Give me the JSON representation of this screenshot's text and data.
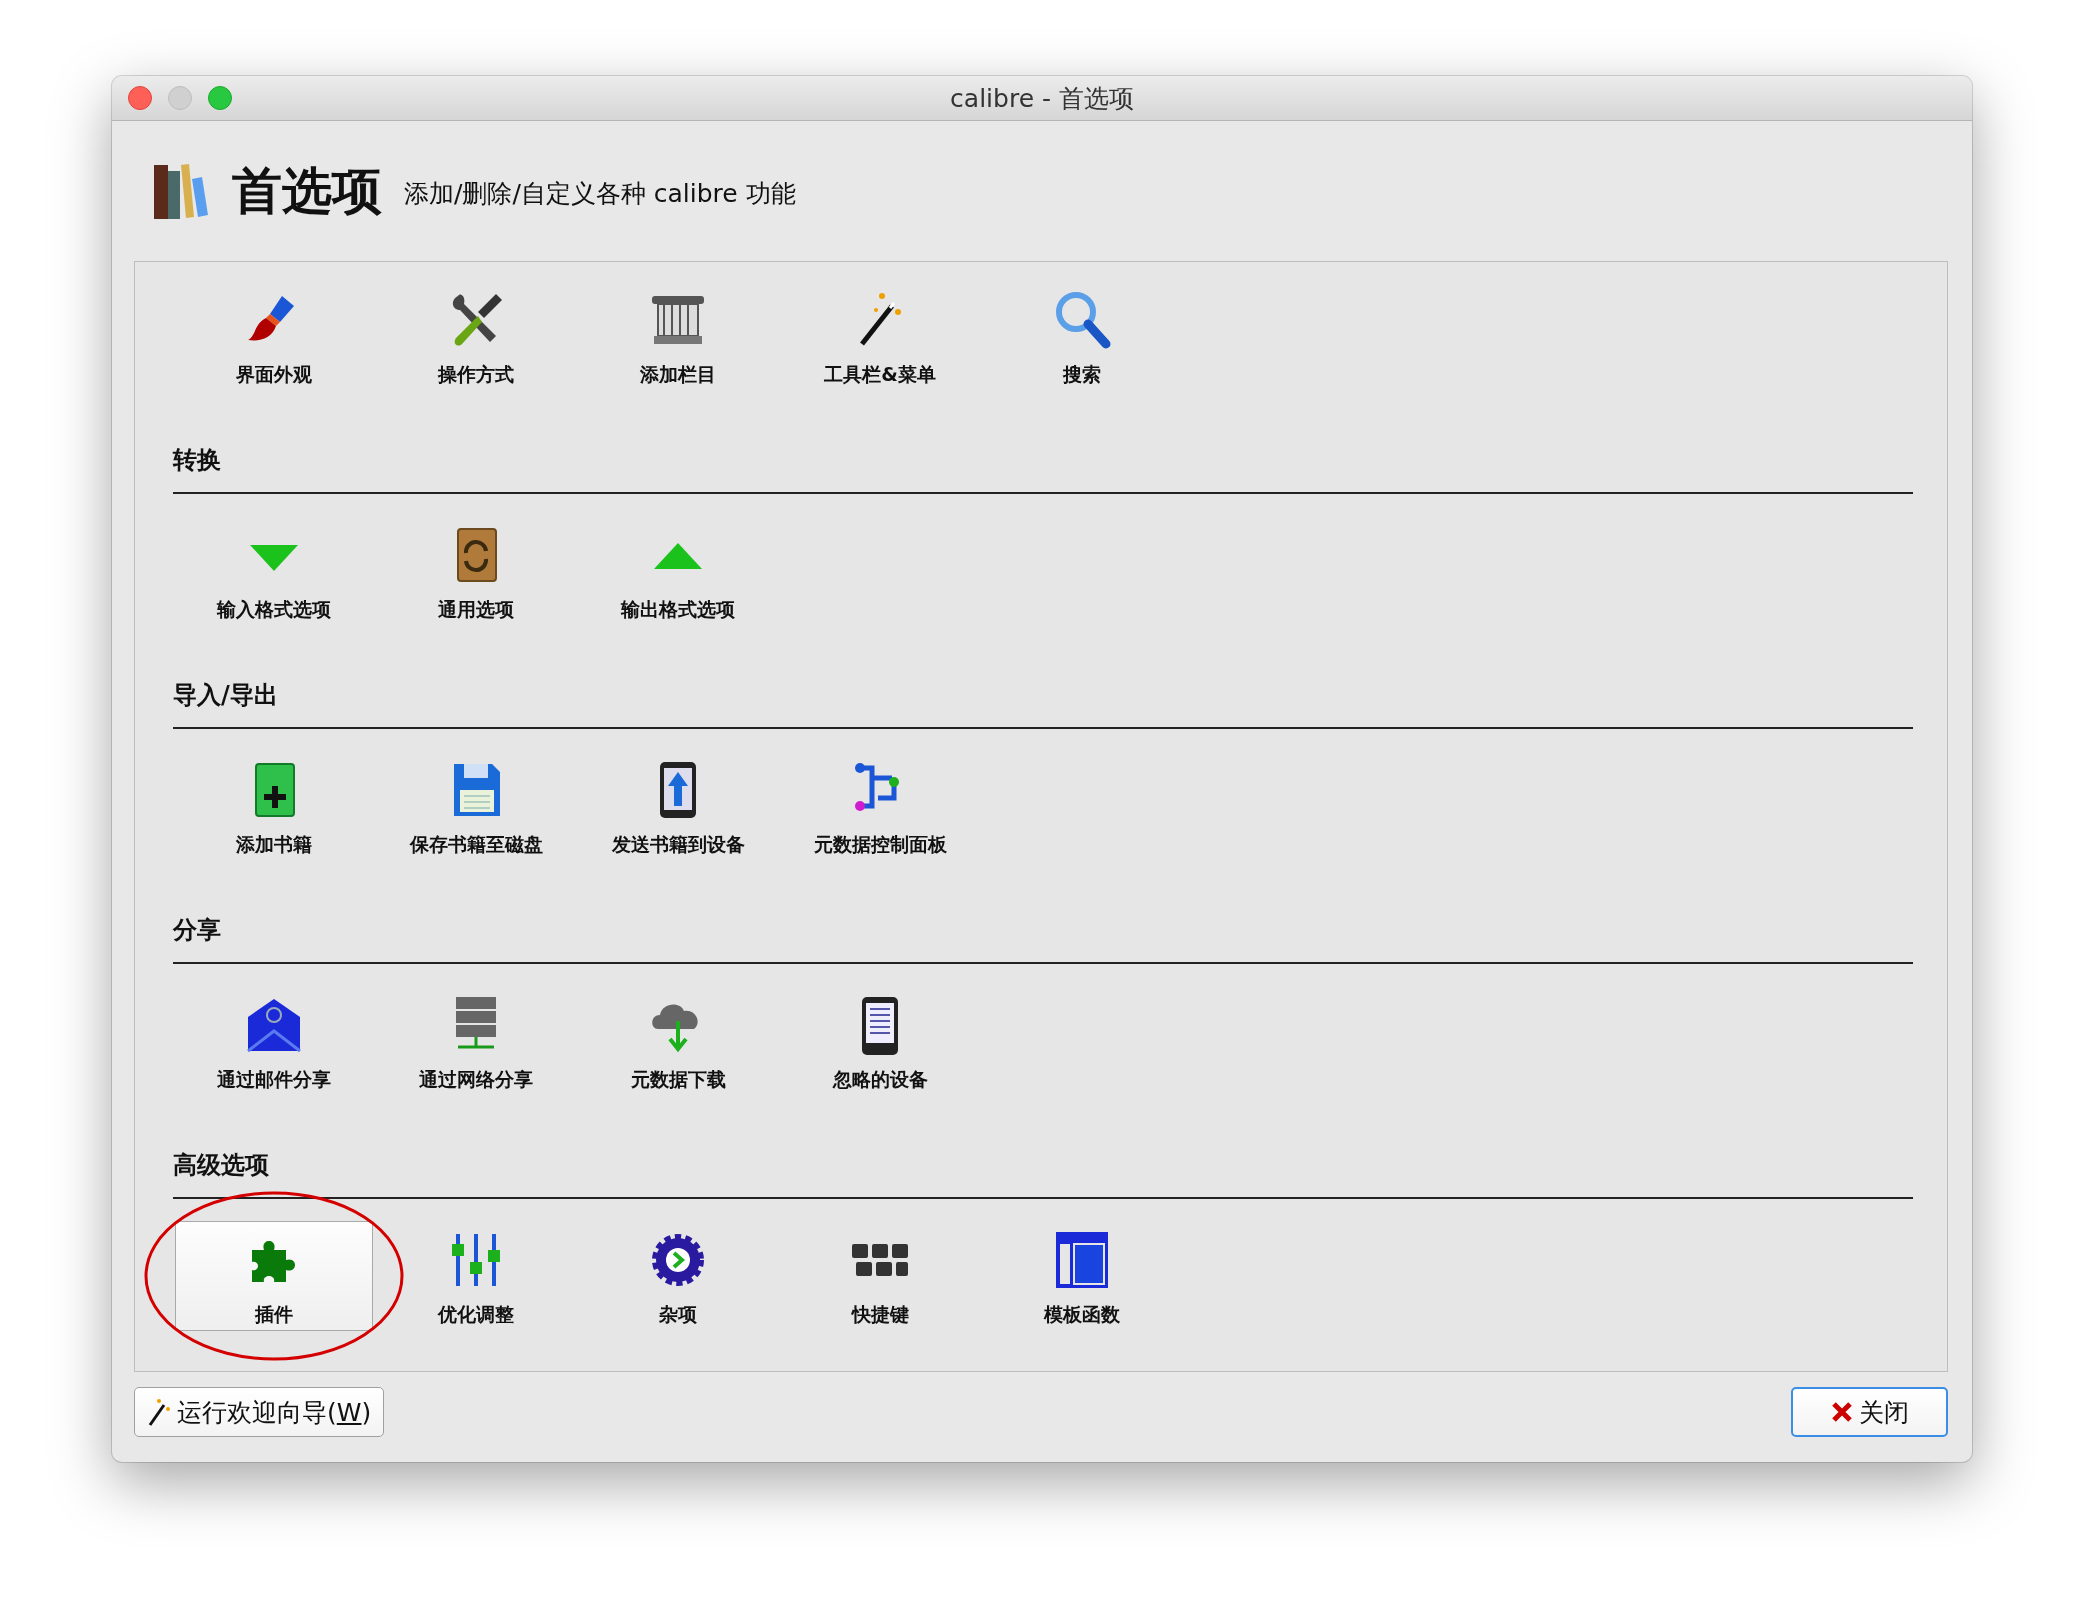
{
  "window": {
    "title": "calibre - 首选项"
  },
  "header": {
    "title": "首选项",
    "subtitle": "添加/删除/自定义各种 calibre 功能"
  },
  "sections": [
    {
      "items": [
        {
          "label": "界面外观",
          "selected": false
        },
        {
          "label": "操作方式",
          "selected": false
        },
        {
          "label": "添加栏目",
          "selected": false
        },
        {
          "label": "工具栏&菜单",
          "selected": false
        },
        {
          "label": "搜索",
          "selected": false
        }
      ]
    },
    {
      "heading": "转换",
      "items": [
        {
          "label": "输入格式选项",
          "selected": false
        },
        {
          "label": "通用选项",
          "selected": false
        },
        {
          "label": "输出格式选项",
          "selected": false
        }
      ]
    },
    {
      "heading": "导入/导出",
      "items": [
        {
          "label": "添加书籍",
          "selected": false
        },
        {
          "label": "保存书籍至磁盘",
          "selected": false
        },
        {
          "label": "发送书籍到设备",
          "selected": false
        },
        {
          "label": "元数据控制面板",
          "selected": false
        }
      ]
    },
    {
      "heading": "分享",
      "items": [
        {
          "label": "通过邮件分享",
          "selected": false
        },
        {
          "label": "通过网络分享",
          "selected": false
        },
        {
          "label": "元数据下载",
          "selected": false
        },
        {
          "label": "忽略的设备",
          "selected": false
        }
      ]
    },
    {
      "heading": "高级选项",
      "items": [
        {
          "label": "插件",
          "selected": true,
          "circled": true
        },
        {
          "label": "优化调整",
          "selected": false
        },
        {
          "label": "杂项",
          "selected": false
        },
        {
          "label": "快捷键",
          "selected": false
        },
        {
          "label": "模板函数",
          "selected": false
        }
      ]
    }
  ],
  "footer": {
    "wizard_button": {
      "label": "运行欢迎向导(",
      "mnemonic": "W",
      "suffix": ")"
    },
    "close_button": {
      "label": "关闭"
    }
  }
}
